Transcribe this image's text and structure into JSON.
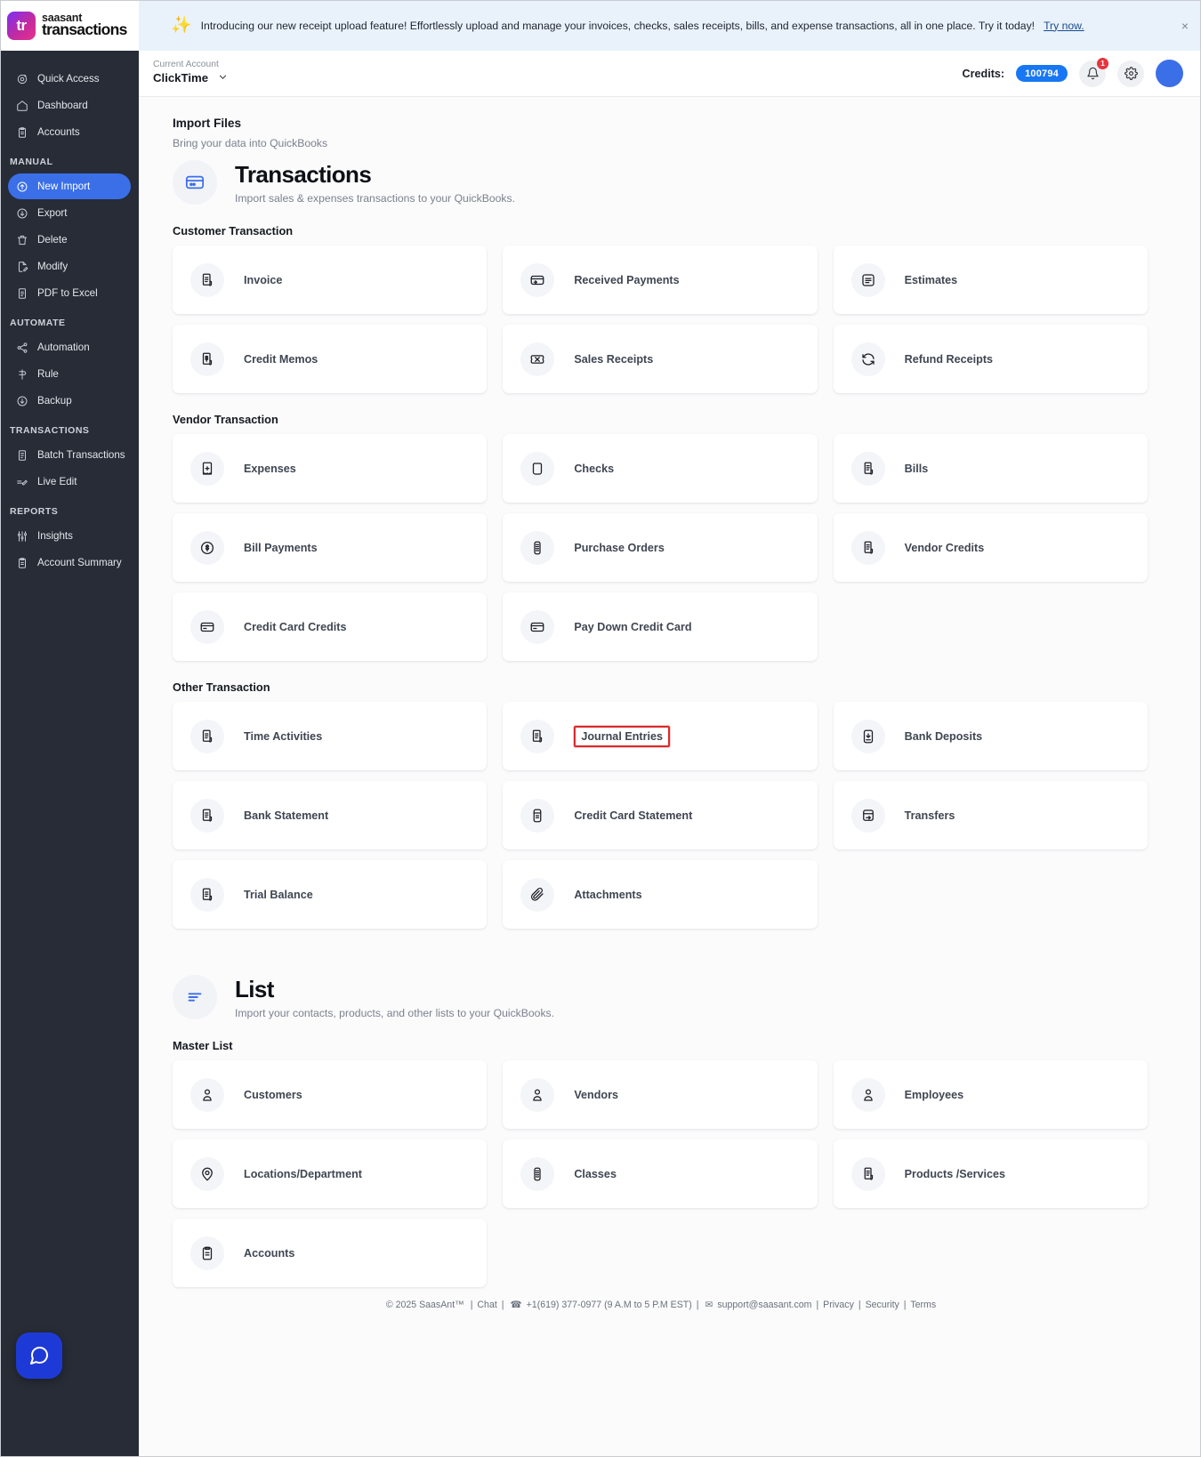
{
  "brand": {
    "line1": "saasant",
    "line2": "transactions",
    "mark": "tr"
  },
  "sidebar": {
    "top_items": [
      {
        "label": "Quick Access",
        "icon": "target-icon"
      },
      {
        "label": "Dashboard",
        "icon": "home-icon"
      },
      {
        "label": "Accounts",
        "icon": "clipboard-icon"
      }
    ],
    "sections": [
      {
        "label": "MANUAL",
        "items": [
          {
            "label": "New Import",
            "icon": "upload-cloud-icon",
            "active": true
          },
          {
            "label": "Export",
            "icon": "download-cloud-icon",
            "active": false
          },
          {
            "label": "Delete",
            "icon": "trash-icon",
            "active": false
          },
          {
            "label": "Modify",
            "icon": "file-edit-icon",
            "active": false
          },
          {
            "label": "PDF to Excel",
            "icon": "file-pdf-icon",
            "active": false
          }
        ]
      },
      {
        "label": "AUTOMATE",
        "items": [
          {
            "label": "Automation",
            "icon": "share-nodes-icon",
            "active": false
          },
          {
            "label": "Rule",
            "icon": "rule-icon",
            "active": false
          },
          {
            "label": "Backup",
            "icon": "backup-cloud-icon",
            "active": false
          }
        ]
      },
      {
        "label": "TRANSACTIONS",
        "items": [
          {
            "label": "Batch Transactions",
            "icon": "document-icon",
            "active": false
          },
          {
            "label": "Live Edit",
            "icon": "pencil-line-icon",
            "active": false
          }
        ]
      },
      {
        "label": "REPORTS",
        "items": [
          {
            "label": "Insights",
            "icon": "sliders-icon",
            "active": false
          },
          {
            "label": "Account Summary",
            "icon": "clipboard-icon",
            "active": false
          }
        ]
      }
    ]
  },
  "banner": {
    "icon": "sparkle-icon",
    "text": "Introducing our new receipt upload feature! Effortlessly upload and manage your invoices, checks, sales receipts, bills, and expense transactions, all in one place. Try it today!",
    "link": "Try now.",
    "close": "×"
  },
  "topbar": {
    "account_label": "Current Account",
    "account_value": "ClickTime",
    "chevron": "⌄",
    "credits_label": "Credits:",
    "credits_value": "100794",
    "notification_badge": "1"
  },
  "page": {
    "eyebrow_title": "Import Files",
    "eyebrow_sub": "Bring your data into QuickBooks"
  },
  "transactions_block": {
    "icon": "credit-card-icon",
    "title": "Transactions",
    "desc": "Import sales & expenses transactions to your QuickBooks.",
    "groups": [
      {
        "title": "Customer Transaction",
        "cards": [
          {
            "label": "Invoice",
            "icon": "invoice-icon",
            "highlighted": false
          },
          {
            "label": "Received Payments",
            "icon": "card-in-icon",
            "highlighted": false
          },
          {
            "label": "Estimates",
            "icon": "estimate-doc-icon",
            "highlighted": false
          },
          {
            "label": "Credit Memos",
            "icon": "memo-dollar-icon",
            "highlighted": false
          },
          {
            "label": "Sales Receipts",
            "icon": "ticket-icon",
            "highlighted": false
          },
          {
            "label": "Refund Receipts",
            "icon": "refresh-icon",
            "highlighted": false
          }
        ]
      },
      {
        "title": "Vendor Transaction",
        "cards": [
          {
            "label": "Expenses",
            "icon": "expense-icon",
            "highlighted": false
          },
          {
            "label": "Checks",
            "icon": "check-shape-icon",
            "highlighted": false
          },
          {
            "label": "Bills",
            "icon": "bill-icon",
            "highlighted": false
          },
          {
            "label": "Bill Payments",
            "icon": "coin-dollar-icon",
            "highlighted": false
          },
          {
            "label": "Purchase Orders",
            "icon": "purchase-order-icon",
            "highlighted": false
          },
          {
            "label": "Vendor Credits",
            "icon": "bill-icon",
            "highlighted": false
          },
          {
            "label": "Credit Card Credits",
            "icon": "credit-card-icon",
            "highlighted": false
          },
          {
            "label": "Pay Down Credit Card",
            "icon": "credit-card-icon",
            "highlighted": false
          }
        ]
      },
      {
        "title": "Other Transaction",
        "cards": [
          {
            "label": "Time Activities",
            "icon": "invoice-icon",
            "highlighted": false
          },
          {
            "label": "Journal Entries",
            "icon": "invoice-icon",
            "highlighted": true
          },
          {
            "label": "Bank Deposits",
            "icon": "deposit-icon",
            "highlighted": false
          },
          {
            "label": "Bank Statement",
            "icon": "invoice-icon",
            "highlighted": false
          },
          {
            "label": "Credit Card Statement",
            "icon": "card-statement-icon",
            "highlighted": false
          },
          {
            "label": "Transfers",
            "icon": "transfer-icon",
            "highlighted": false
          },
          {
            "label": "Trial Balance",
            "icon": "invoice-icon",
            "highlighted": false
          },
          {
            "label": "Attachments",
            "icon": "paperclip-icon",
            "highlighted": false
          }
        ]
      }
    ]
  },
  "list_block": {
    "icon": "list-lines-icon",
    "title": "List",
    "desc": "Import your contacts, products, and other lists to your QuickBooks.",
    "groups": [
      {
        "title": "Master List",
        "cards": [
          {
            "label": "Customers",
            "icon": "person-icon",
            "highlighted": false
          },
          {
            "label": "Vendors",
            "icon": "person-icon",
            "highlighted": false
          },
          {
            "label": "Employees",
            "icon": "person-icon",
            "highlighted": false
          },
          {
            "label": "Locations/Department",
            "icon": "location-pin-icon",
            "highlighted": false
          },
          {
            "label": "Classes",
            "icon": "purchase-order-icon",
            "highlighted": false
          },
          {
            "label": "Products /Services",
            "icon": "bill-icon",
            "highlighted": false
          },
          {
            "label": "Accounts",
            "icon": "clipboard-icon",
            "highlighted": false
          }
        ]
      }
    ]
  },
  "footer": {
    "copyright": "© 2025 SaasAnt™",
    "sep": "|",
    "chat": "Chat",
    "phone_icon": "phone-icon",
    "phone": "+1(619) 377-0977 (9 A.M to 5 P.M EST)",
    "mail_icon": "mail-icon",
    "email": "support@saasant.com",
    "privacy": "Privacy",
    "security": "Security",
    "terms": "Terms"
  },
  "chat_widget": {
    "icon": "chat-bubble-icon"
  }
}
